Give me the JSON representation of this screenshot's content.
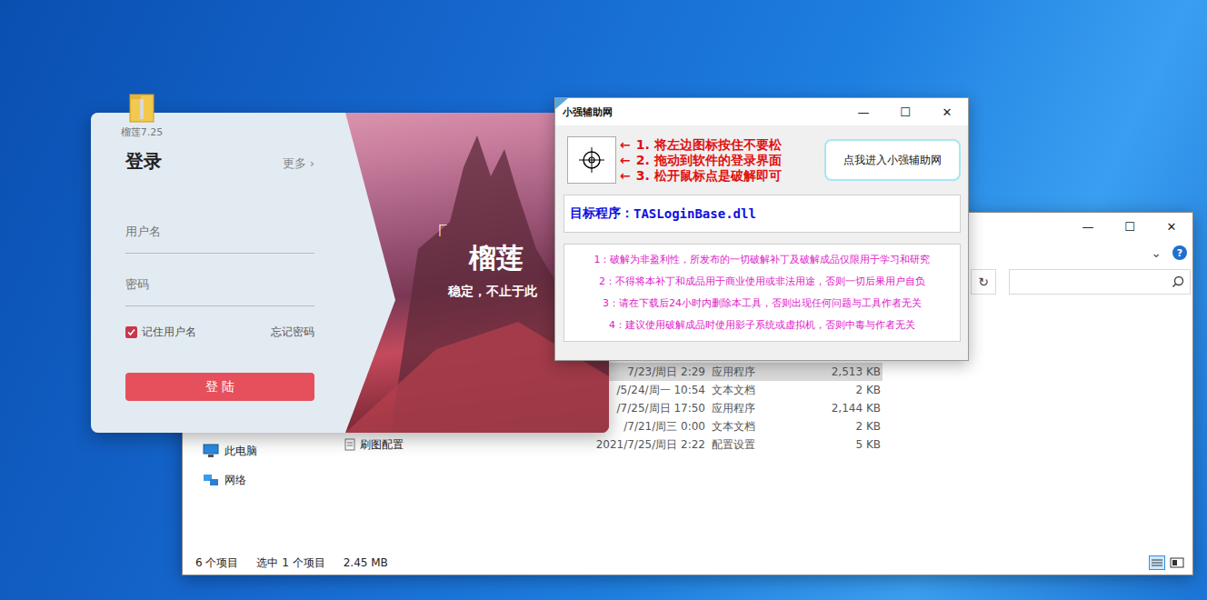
{
  "desktop_icon": {
    "label": "榴莲7.25"
  },
  "explorer": {
    "controls": [
      "—",
      "☐",
      "✕"
    ],
    "ribbon_expand": "⌄",
    "help": "?",
    "refresh": "↻",
    "nav": [
      {
        "label": "此电脑"
      },
      {
        "label": "网络"
      }
    ],
    "rows": [
      {
        "name": "",
        "date": "7/23/周日 2:29",
        "type": "应用程序",
        "size": "2,513 KB",
        "selected": true
      },
      {
        "name": "",
        "date": "/5/24/周一 10:54",
        "type": "文本文档",
        "size": "2 KB",
        "selected": false
      },
      {
        "name": "",
        "date": "/7/25/周日 17:50",
        "type": "应用程序",
        "size": "2,144 KB",
        "selected": false
      },
      {
        "name": "",
        "date": "/7/21/周三 0:00",
        "type": "文本文档",
        "size": "2 KB",
        "selected": false
      },
      {
        "name": "刷图配置",
        "date": "2021/7/25/周日 2:22",
        "type": "配置设置",
        "size": "5 KB",
        "selected": false
      }
    ],
    "status": [
      "6 个项目",
      "选中 1 个项目",
      "2.45 MB"
    ]
  },
  "login": {
    "title": "登录",
    "more": "更多 ›",
    "username_placeholder": "用户名",
    "password_placeholder": "密码",
    "remember": {
      "label": "记住用户名",
      "checked": true
    },
    "forgot": "忘记密码",
    "button": "登 陆",
    "bracket": "「",
    "brand": "榴莲",
    "slogan": "稳定，不止于此"
  },
  "tool": {
    "title": "小强辅助网",
    "controls": [
      "—",
      "☐",
      "✕"
    ],
    "arrow": "←",
    "steps": [
      "1. 将左边图标按住不要松",
      "2. 拖动到软件的登录界面",
      "3. 松开鼠标点是破解即可"
    ],
    "link_button": "点我进入小强辅助网",
    "target_label": "目标程序：",
    "target": "TASLoginBase.dll",
    "notices": [
      "1：破解为非盈利性，所发布的一切破解补丁及破解成品仅限用于学习和研究",
      "2：不得将本补丁和成品用于商业使用或非法用途，否则一切后果用户自负",
      "3：请在下载后24小时内删除本工具，否则出现任何问题与工具作者无关",
      "4：建议使用破解成品时使用影子系统或虚拟机，否则中毒与作者无关"
    ]
  }
}
